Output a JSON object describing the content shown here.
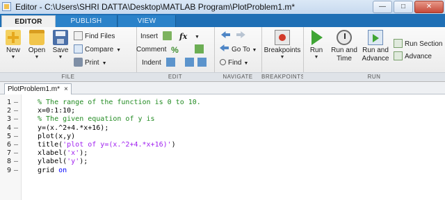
{
  "window": {
    "title": "Editor - C:\\Users\\SHRI DATTA\\Desktop\\MATLAB Program\\PlotProblem1.m*",
    "controls": {
      "minimize": "—",
      "maximize": "□",
      "close": "✕"
    }
  },
  "ribbon_tabs": [
    "EDITOR",
    "PUBLISH",
    "VIEW"
  ],
  "ribbon": {
    "file": {
      "label": "FILE",
      "new": "New",
      "open": "Open",
      "save": "Save",
      "find_files": "Find Files",
      "compare": "Compare",
      "print": "Print"
    },
    "edit": {
      "label": "EDIT",
      "insert": "Insert",
      "fx": "fx",
      "comment": "Comment",
      "indent": "Indent",
      "pct": "%"
    },
    "navigate": {
      "label": "NAVIGATE",
      "go_to": "Go To",
      "find": "Find"
    },
    "breakpoints": {
      "label": "BREAKPOINTS",
      "button": "Breakpoints"
    },
    "run": {
      "label": "RUN",
      "run": "Run",
      "run_and_time_1": "Run and",
      "run_and_time_2": "Time",
      "run_and_advance_1": "Run and",
      "run_and_advance_2": "Advance",
      "run_section": "Run Section",
      "advance": "Advance"
    }
  },
  "document_tab": {
    "name": "PlotProblem1.m*",
    "close": "×"
  },
  "code_lines": [
    {
      "num": "1",
      "parts": [
        {
          "t": "% The range of the function is 0 to 10.",
          "c": "cm"
        }
      ]
    },
    {
      "num": "2",
      "parts": [
        {
          "t": "x=0:1:10;",
          "c": ""
        }
      ]
    },
    {
      "num": "3",
      "parts": [
        {
          "t": "% The given equation of y is",
          "c": "cm"
        }
      ]
    },
    {
      "num": "4",
      "parts": [
        {
          "t": "y=(x.^2+4.*x+16);",
          "c": ""
        }
      ]
    },
    {
      "num": "5",
      "parts": [
        {
          "t": "plot(x,y)",
          "c": ""
        }
      ]
    },
    {
      "num": "6",
      "parts": [
        {
          "t": "title(",
          "c": ""
        },
        {
          "t": "'plot of y=(x.^2+4.*x+16)'",
          "c": "str"
        },
        {
          "t": ")",
          "c": ""
        }
      ]
    },
    {
      "num": "7",
      "parts": [
        {
          "t": "xlabel(",
          "c": ""
        },
        {
          "t": "'x'",
          "c": "str"
        },
        {
          "t": ");",
          "c": ""
        }
      ]
    },
    {
      "num": "8",
      "parts": [
        {
          "t": "ylabel(",
          "c": ""
        },
        {
          "t": "'y'",
          "c": "str"
        },
        {
          "t": ");",
          "c": ""
        }
      ]
    },
    {
      "num": "9",
      "parts": [
        {
          "t": "grid ",
          "c": ""
        },
        {
          "t": "on",
          "c": "kw"
        }
      ]
    }
  ],
  "line_marker": "–",
  "colors": {
    "ribbon_tab_bar": "#1f6fb5",
    "comment": "#228b22",
    "string": "#a020f0",
    "keyword": "#0000ff"
  }
}
